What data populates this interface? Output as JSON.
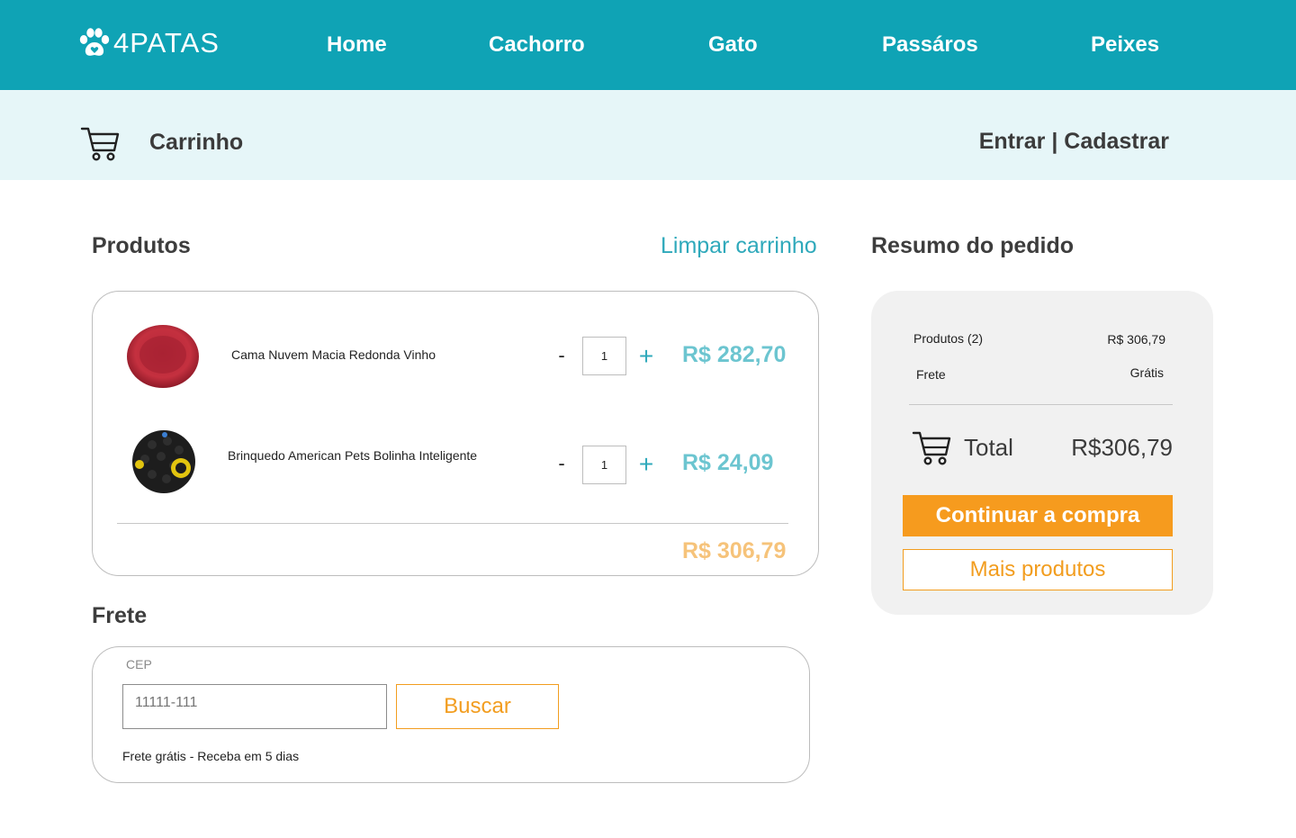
{
  "brand": {
    "logo_text": "4PATAS",
    "icon": "paw-icon"
  },
  "nav": {
    "items": [
      {
        "label": "Home"
      },
      {
        "label": "Cachorro"
      },
      {
        "label": "Gato"
      },
      {
        "label": "Passáros"
      },
      {
        "label": "Peixes"
      }
    ]
  },
  "subheader": {
    "icon": "cart-icon",
    "title": "Carrinho",
    "login_label": "Entrar",
    "separator": " | ",
    "register_label": "Cadastrar"
  },
  "products_section": {
    "title": "Produtos",
    "clear_label": "Limpar carrinho",
    "items": [
      {
        "name": "Cama Nuvem Macia Redonda Vinho",
        "quantity": "1",
        "price": "R$ 282,70",
        "image": "red-round-pet-bed"
      },
      {
        "name": "Brinquedo American Pets Bolinha Inteligente",
        "quantity": "1",
        "price": "R$ 24,09",
        "image": "black-treat-ball-toy"
      }
    ],
    "minus_label": "-",
    "plus_label": "+",
    "subtotal": "R$ 306,79"
  },
  "shipping": {
    "title": "Frete",
    "cep_label": "CEP",
    "cep_placeholder": "11111-111",
    "search_label": "Buscar",
    "info": "Frete grátis - Receba em 5 dias"
  },
  "summary": {
    "title": "Resumo do pedido",
    "products_label": "Produtos (2)",
    "products_value": "R$ 306,79",
    "shipping_label": "Frete",
    "shipping_value": "Grátis",
    "total_label": "Total",
    "total_value": "R$306,79",
    "continue_label": "Continuar a compra",
    "more_label": "Mais produtos"
  },
  "colors": {
    "header": "#0fa3b5",
    "subheader": "#e6f6f8",
    "accent_teal": "#2fa9bb",
    "accent_orange": "#f69b1e",
    "subtotal": "#f6c37a"
  }
}
